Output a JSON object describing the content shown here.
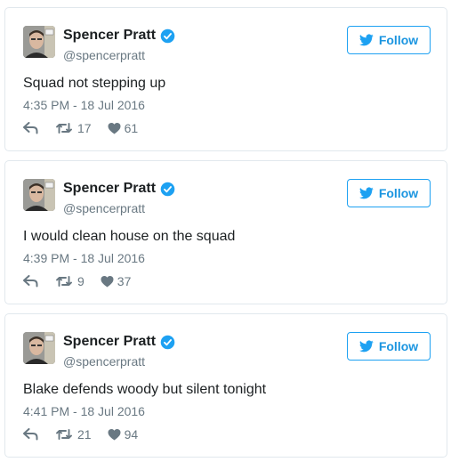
{
  "tweets": [
    {
      "author": {
        "name": "Spencer Pratt",
        "handle": "@spencerpratt",
        "verified": true
      },
      "follow_label": "Follow",
      "text": "Squad not stepping up",
      "timestamp": "4:35 PM - 18 Jul 2016",
      "retweets": "17",
      "likes": "61"
    },
    {
      "author": {
        "name": "Spencer Pratt",
        "handle": "@spencerpratt",
        "verified": true
      },
      "follow_label": "Follow",
      "text": "I would clean house on the squad",
      "timestamp": "4:39 PM - 18 Jul 2016",
      "retweets": "9",
      "likes": "37"
    },
    {
      "author": {
        "name": "Spencer Pratt",
        "handle": "@spencerpratt",
        "verified": true
      },
      "follow_label": "Follow",
      "text": "Blake defends woody but silent tonight",
      "timestamp": "4:41 PM - 18 Jul 2016",
      "retweets": "21",
      "likes": "94"
    }
  ],
  "icons": {
    "verified": "verified-badge-icon",
    "follow": "twitter-bird-icon",
    "reply": "reply-icon",
    "retweet": "retweet-icon",
    "like": "heart-icon"
  },
  "colors": {
    "accent": "#1da1f2",
    "text": "#1c2022",
    "muted": "#697882",
    "border": "#e1e8ed"
  }
}
